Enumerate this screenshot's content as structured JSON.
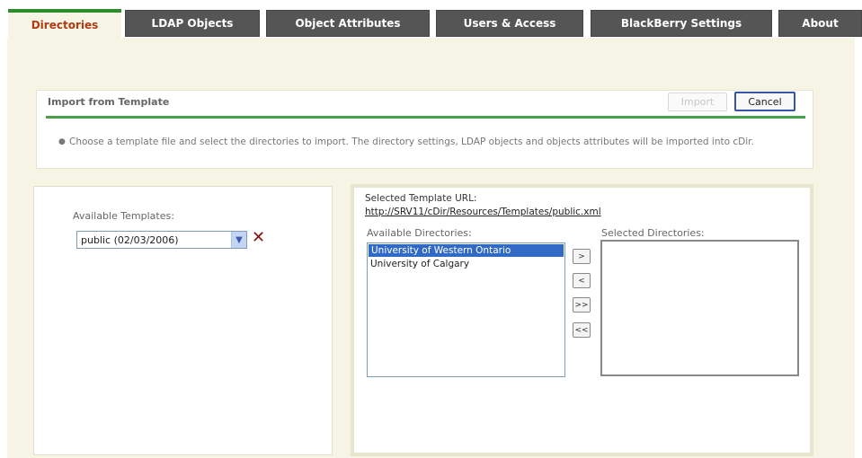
{
  "tabs": [
    {
      "label": "Directories",
      "active": true
    },
    {
      "label": "LDAP Objects",
      "active": false
    },
    {
      "label": "Object Attributes",
      "active": false
    },
    {
      "label": "Users & Access",
      "active": false
    },
    {
      "label": "BlackBerry Settings",
      "active": false
    },
    {
      "label": "About",
      "active": false
    }
  ],
  "import_panel": {
    "title": "Import from Template",
    "import_label": "Import",
    "cancel_label": "Cancel",
    "help_text": "Choose a template file and select the directories to import. The directory settings, LDAP objects and objects attributes will be imported into cDir."
  },
  "templates": {
    "label": "Available Templates:",
    "selected": "public (02/03/2006)"
  },
  "directories": {
    "url_label": "Selected Template URL:",
    "url": "http://SRV11/cDir/Resources/Templates/public.xml",
    "available_label": "Available Directories:",
    "selected_label": "Selected Directories:",
    "available": [
      "University of Western Ontario",
      "University of Calgary"
    ],
    "selected": [],
    "buttons": [
      ">",
      "<",
      ">>",
      "<<"
    ]
  },
  "colors": {
    "active_tab_text": "#b23a12",
    "accent_green": "#4aa048",
    "tab_bg": "#555555",
    "content_bg": "#f6f4e4"
  }
}
